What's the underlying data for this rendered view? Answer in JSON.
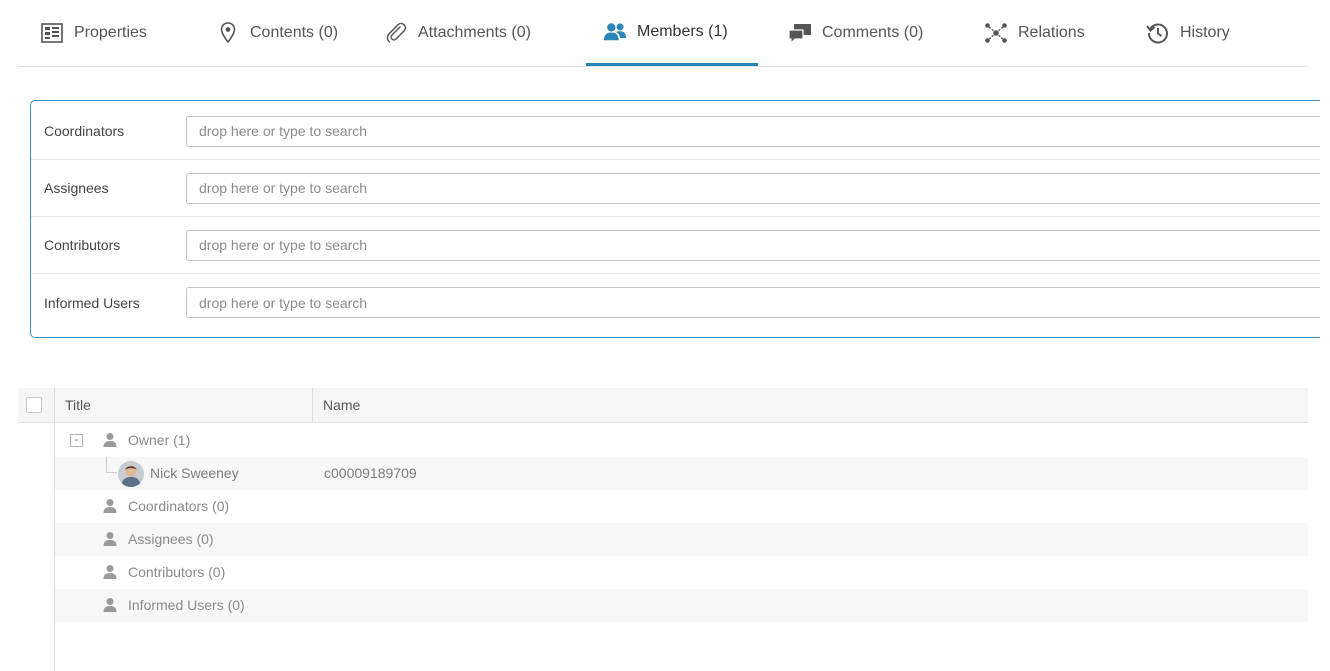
{
  "tabs": [
    {
      "label": "Properties",
      "icon": "properties-icon"
    },
    {
      "label": "Contents (0)",
      "icon": "location-pin-icon"
    },
    {
      "label": "Attachments (0)",
      "icon": "paperclip-icon"
    },
    {
      "label": "Members (1)",
      "icon": "users-icon"
    },
    {
      "label": "Comments (0)",
      "icon": "comments-icon"
    },
    {
      "label": "Relations",
      "icon": "relations-icon"
    },
    {
      "label": "History",
      "icon": "history-icon"
    }
  ],
  "active_tab": "Members (1)",
  "colors": {
    "accent": "#2b86b8",
    "panel_border": "#3b8fc2",
    "icon_gray": "#9a9a9a"
  },
  "fields": [
    {
      "label": "Coordinators",
      "placeholder": "drop here or type to search",
      "value": ""
    },
    {
      "label": "Assignees",
      "placeholder": "drop here or type to search",
      "value": ""
    },
    {
      "label": "Contributors",
      "placeholder": "drop here or type to search",
      "value": ""
    },
    {
      "label": "Informed Users",
      "placeholder": "drop here or type to search",
      "value": ""
    }
  ],
  "grid": {
    "headers": {
      "title": "Title",
      "name": "Name"
    },
    "groups": {
      "owner": {
        "label": "Owner (1)",
        "toggle": "-"
      },
      "owner_member": {
        "title": "Nick Sweeney",
        "name": "c00009189709"
      },
      "coordinators": {
        "label": "Coordinators (0)"
      },
      "assignees": {
        "label": "Assignees (0)"
      },
      "contributors": {
        "label": "Contributors (0)"
      },
      "informed": {
        "label": "Informed Users (0)"
      }
    }
  }
}
